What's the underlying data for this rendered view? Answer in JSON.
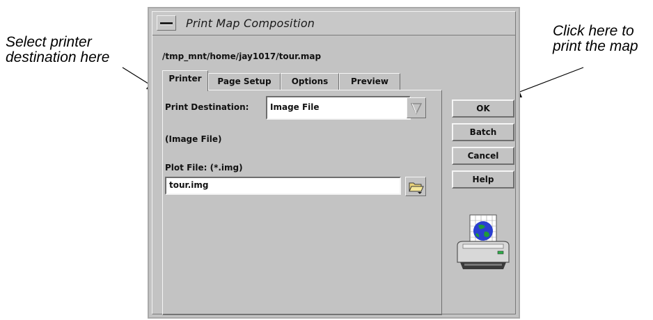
{
  "callouts": {
    "left_line1": "Select printer",
    "left_line2": "destination here",
    "right_line1": "Click here to",
    "right_line2": "print the map"
  },
  "window": {
    "title": "Print Map Composition",
    "path": "/tmp_mnt/home/jay1017/tour.map"
  },
  "tabs": [
    "Printer",
    "Page Setup",
    "Options",
    "Preview"
  ],
  "printer_tab": {
    "destination_label": "Print Destination:",
    "destination_value": "Image File",
    "destination_type": "(Image File)",
    "plot_file_label": "Plot File: (*.img)",
    "plot_file_value": "tour.img"
  },
  "buttons": {
    "ok": "OK",
    "batch": "Batch",
    "cancel": "Cancel",
    "help": "Help"
  },
  "icons": {
    "dropdown": "triangle-down-icon",
    "file_browse": "folder-icon",
    "printer": "printer-icon"
  }
}
